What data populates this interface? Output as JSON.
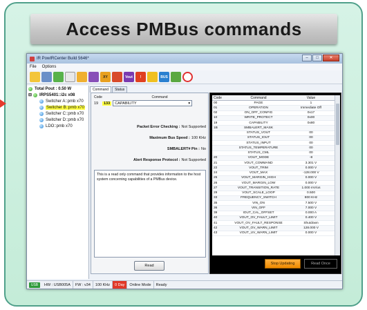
{
  "banner": {
    "title": "Access PMBus commands"
  },
  "window": {
    "title": "IR PowIRCenter Build 5646*",
    "buttons": {
      "minimize": "–",
      "maximize": "□",
      "close": "✕"
    },
    "menu": [
      "File",
      "Options"
    ],
    "toolbar_icons": [
      "open-icon",
      "grid-icon",
      "new-icon",
      "document-icon",
      "folder-icon",
      "save-icon",
      "xy-icon",
      "config-icon",
      "vout-icon",
      "warning-icon",
      "chart-icon",
      "bus-icon",
      "hex-icon",
      "lifebuoy-icon"
    ],
    "toolbar_labels": {
      "vout": "Vout",
      "bus": "BUS"
    }
  },
  "tree": {
    "total": "Total Pout : 0.50 W",
    "device": "IRPS5401::i2c x08",
    "items": [
      {
        "label": "Switcher A::pmb x70"
      },
      {
        "label": "Switcher B::pmb x70",
        "selected": true
      },
      {
        "label": "Switcher C::pmb x70"
      },
      {
        "label": "Switcher D::pmb x70"
      },
      {
        "label": "LDO::pmb x70"
      }
    ]
  },
  "tabs": [
    "Command",
    "Status"
  ],
  "command": {
    "code_header": "Code",
    "command_header": "Command",
    "code_dec": "19",
    "code_hex": "133",
    "selected": "CAPABILITY",
    "pec_label": "Packet Error Checking :",
    "pec_value": "Not Supported",
    "speed_label": "Maximum Bus Speed :",
    "speed_value": "100 KHz",
    "alert_label": "SMBALERT# Pin :",
    "alert_value": "No",
    "arp_label": "Alert Response Protocol :",
    "arp_value": "Not Supported",
    "description": "This is a read only command that provides information to the host system concerning capabilities of a PMBus device.",
    "read_button": "Read"
  },
  "table": {
    "headers": [
      "Code",
      "Command",
      "Value"
    ],
    "rows": [
      [
        "00",
        "PAGE",
        "1"
      ],
      [
        "01",
        "OPERATION",
        "Immediate Off"
      ],
      [
        "02",
        "ON_OFF_CONFIG",
        "0x17"
      ],
      [
        "10",
        "WRITE_PROTECT",
        "0x00"
      ],
      [
        "19",
        "CAPABILITY",
        "0x80"
      ],
      [
        "1B",
        "SMBALERT_MASK",
        ""
      ],
      [
        "",
        "STATUS_VOUT",
        "00"
      ],
      [
        "",
        "STATUS_IOUT",
        "00"
      ],
      [
        "",
        "STATUS_INPUT",
        "00"
      ],
      [
        "",
        "STATUS_TEMPERATURE",
        "00"
      ],
      [
        "",
        "STATUS_CML",
        "00"
      ],
      [
        "20",
        "VOUT_MODE",
        "-8"
      ],
      [
        "21",
        "VOUT_COMMAND",
        "3.301 V"
      ],
      [
        "22",
        "VOUT_TRIM",
        "0.000 V"
      ],
      [
        "24",
        "VOUT_MAX",
        "-128.000 V"
      ],
      [
        "25",
        "VOUT_MARGIN_HIGH",
        "0.000 V"
      ],
      [
        "26",
        "VOUT_MARGIN_LOW",
        "0.000 V"
      ],
      [
        "27",
        "VOUT_TRANSITION_RATE",
        "1.000 mV/us"
      ],
      [
        "29",
        "VOUT_SCALE_LOOP",
        "0.500"
      ],
      [
        "33",
        "FREQUENCY_SWITCH",
        "800 KHz"
      ],
      [
        "35",
        "VIN_ON",
        "7.500 V"
      ],
      [
        "36",
        "VIN_OFF",
        "7.000 V"
      ],
      [
        "39",
        "IOUT_CAL_OFFSET",
        "0.000 A"
      ],
      [
        "40",
        "VOUT_OV_FAULT_LIMIT",
        "0.400 V"
      ],
      [
        "41",
        "VOUT_OV_FAULT_RESPONSE",
        "Shutdown"
      ],
      [
        "42",
        "VOUT_OV_WARN_LIMIT",
        "128.000 V"
      ],
      [
        "43",
        "VOUT_UV_WARN_LIMIT",
        "0.000 V"
      ]
    ],
    "stop_button": "Stop Updating",
    "once_button": "Read Once"
  },
  "status": {
    "hw": "HW : USB005A",
    "fw": "FW : v34",
    "freq": "100 KHz",
    "day": "0 Day",
    "mode": "Online Mode",
    "state": "Ready",
    "usb": "USB"
  },
  "colors": {
    "accent_green": "#4fa08a",
    "selection_yellow": "#ffff40",
    "stop_orange": "#ee8a00"
  }
}
